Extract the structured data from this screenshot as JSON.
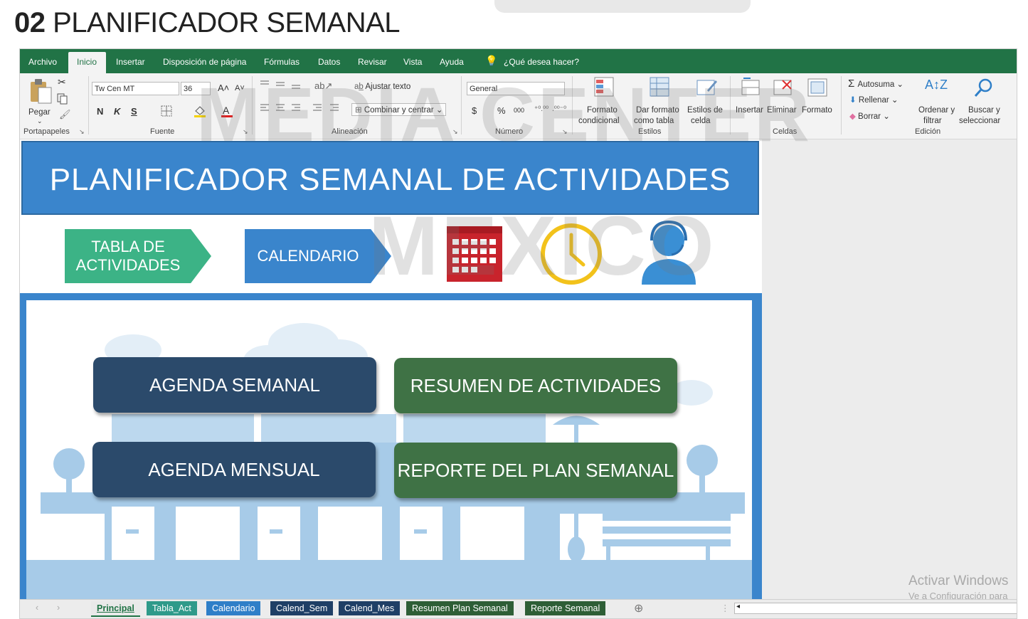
{
  "page_title": {
    "number": "02",
    "text": "PLANIFICADOR SEMANAL"
  },
  "ribbon": {
    "tabs": [
      "Archivo",
      "Inicio",
      "Insertar",
      "Disposición de página",
      "Fórmulas",
      "Datos",
      "Revisar",
      "Vista",
      "Ayuda"
    ],
    "active_tab": "Inicio",
    "tell_me": "¿Qué desea hacer?",
    "clipboard": {
      "paste": "Pegar",
      "group": "Portapapeles"
    },
    "font": {
      "name": "Tw Cen MT",
      "size": "36",
      "bold": "N",
      "italic": "K",
      "underline": "S",
      "group": "Fuente"
    },
    "alignment": {
      "wrap": "Ajustar texto",
      "merge": "Combinar y centrar",
      "group": "Alineación"
    },
    "number": {
      "format": "General",
      "currency": "$",
      "percent": "%",
      "thousands": "000",
      "group": "Número"
    },
    "styles": {
      "conditional_1": "Formato",
      "conditional_2": "condicional",
      "table_1": "Dar formato",
      "table_2": "como tabla",
      "cell_1": "Estilos de",
      "cell_2": "celda",
      "group": "Estilos"
    },
    "cells": {
      "insert": "Insertar",
      "delete": "Eliminar",
      "format": "Formato",
      "group": "Celdas"
    },
    "editing": {
      "autosum": "Autosuma",
      "fill": "Rellenar",
      "clear": "Borrar",
      "sort_1": "Ordenar y",
      "sort_2": "filtrar",
      "find_1": "Buscar y",
      "find_2": "seleccionar",
      "group": "Edición"
    }
  },
  "sheet": {
    "banner_title": "PLANIFICADOR SEMANAL DE ACTIVIDADES",
    "nav": {
      "activities_line1": "TABLA DE",
      "activities_line2": "ACTIVIDADES",
      "calendar": "CALENDARIO"
    },
    "buttons": {
      "weekly": "AGENDA SEMANAL",
      "summary": "RESUMEN DE ACTIVIDADES",
      "monthly": "AGENDA MENSUAL",
      "report": "REPORTE DEL PLAN SEMANAL"
    }
  },
  "watermark": {
    "line1": "MEDIA CENTER",
    "line2": "MEXICO"
  },
  "activation": {
    "line1": "Activar Windows",
    "line2": "Ve a Configuración para"
  },
  "sheet_tabs": [
    {
      "label": "Principal",
      "color": "#e9e9e9"
    },
    {
      "label": "Tabla_Act",
      "color": "#2f9a8a"
    },
    {
      "label": "Calendario",
      "color": "#2f7fc8"
    },
    {
      "label": "Calend_Sem",
      "color": "#1f3f66"
    },
    {
      "label": "Calend_Mes",
      "color": "#1f3f66"
    },
    {
      "label": "Resumen Plan Semanal",
      "color": "#2e5e36"
    },
    {
      "label": "Reporte Semanal",
      "color": "#2e5e36"
    }
  ],
  "colors": {
    "excel_green": "#217346",
    "banner_blue": "#3a85cc",
    "navy": "#2b4a6b",
    "green": "#3f7245",
    "teal": "#3cb386",
    "calendar_red": "#c8232c",
    "clock_yellow": "#f2c21b",
    "person_blue": "#3a8fd4"
  }
}
